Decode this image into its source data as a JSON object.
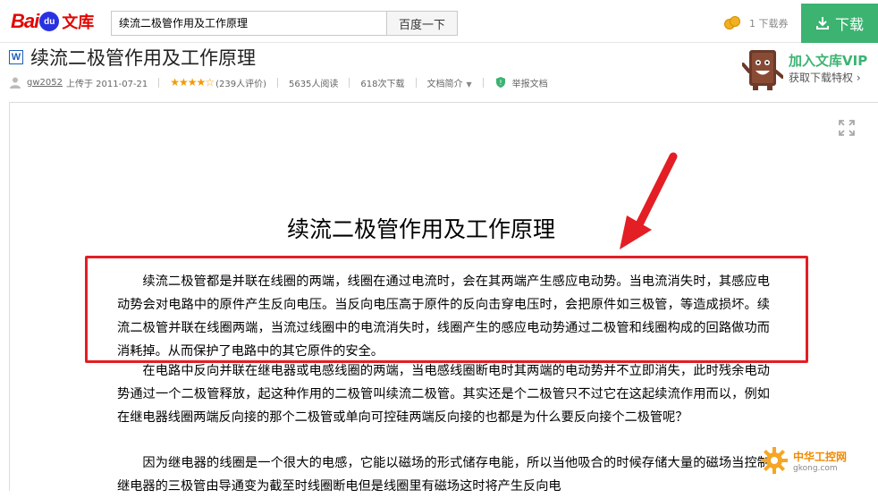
{
  "header": {
    "logo_bai": "Bai",
    "logo_du": "du",
    "logo_wenku": "文库",
    "search_value": "续流二极管作用及工作原理",
    "search_button": "百度一下",
    "coupon_label": "1 下载券",
    "download_button": "下载",
    "accent_color": "#3cb371"
  },
  "document": {
    "type_icon": "W",
    "title": "续流二极管作用及工作原理",
    "meta": {
      "uploader": "gw2052",
      "uploaded": "上传于 2011-07-21",
      "rating_stars": "★★★★☆",
      "rating_value": 4.5,
      "ratings": "(239人评价)",
      "reads": "5635人阅读",
      "downloads": "618次下载",
      "summary": "文档简介",
      "report": "举报文档"
    }
  },
  "vip": {
    "title": "加入文库VIP",
    "subtitle": "获取下载特权 ›"
  },
  "page": {
    "heading": "续流二极管作用及工作原理",
    "paragraphs": [
      "续流二极管都是并联在线圈的两端，线圈在通过电流时，会在其两端产生感应电动势。当电流消失时，其感应电动势会对电路中的原件产生反向电压。当反向电压高于原件的反向击穿电压时，会把原件如三极管，等造成损坏。续流二极管并联在线圈两端，当流过线圈中的电流消失时，线圈产生的感应电动势通过二极管和线圈构成的回路做功而消耗掉。从而保护了电路中的其它原件的安全。",
      "在电路中反向并联在继电器或电感线圈的两端，当电感线圈断电时其两端的电动势并不立即消失，此时残余电动势通过一个二极管释放，起这种作用的二极管叫续流二极管。其实还是个二极管只不过它在这起续流作用而以，例如在继电器线圈两端反向接的那个二极管或单向可控硅两端反向接的也都是为什么要反向接个二极管呢？",
      "因为继电器的线圈是一个很大的电感，它能以磁场的形式储存电能，所以当他吸合的时候存储大量的磁场当控制继电器的三极管由导通变为截至时线圈断电但是线圈里有磁场这时将产生反向电"
    ]
  },
  "watermark": {
    "name": "中华工控网",
    "url": "gkong.com"
  },
  "annotation_color": "#e31e24"
}
